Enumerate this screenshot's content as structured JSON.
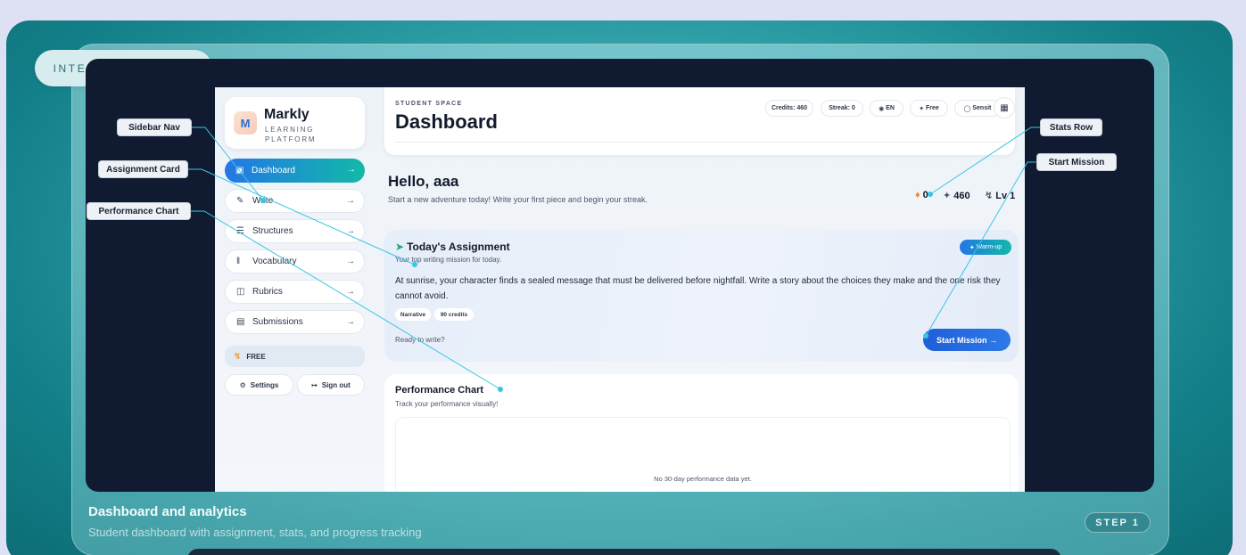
{
  "tour": {
    "badge": "INTERACTIVE TOUR",
    "footer_title": "Dashboard and analytics",
    "footer_subtitle": "Student dashboard with assignment, stats, and progress tracking",
    "step": "STEP 1"
  },
  "callouts": {
    "sidebar_nav": "Sidebar Nav",
    "assignment_card": "Assignment Card",
    "performance_chart": "Performance Chart",
    "stats_row": "Stats Row",
    "start_mission": "Start Mission"
  },
  "app": {
    "logo": {
      "name": "Markly",
      "subtitle": "LEARNING PLATFORM",
      "mark_text": "M"
    },
    "nav": [
      {
        "label": "Dashboard",
        "icon": "book-open-icon"
      },
      {
        "label": "Write",
        "icon": "pen-icon"
      },
      {
        "label": "Structures",
        "icon": "layers-icon"
      },
      {
        "label": "Vocabulary",
        "icon": "library-icon"
      },
      {
        "label": "Rubrics",
        "icon": "clipboard-icon"
      },
      {
        "label": "Submissions",
        "icon": "file-icon"
      }
    ],
    "plan": "FREE",
    "settings_label": "Settings",
    "signout_label": "Sign out",
    "header": {
      "eyebrow": "STUDENT SPACE",
      "title": "Dashboard",
      "chips": [
        "Credits: 460",
        "Streak: 0",
        "EN",
        "Free",
        "Sensit"
      ]
    },
    "greeting": "Hello, aaa",
    "greeting_sub": "Start a new adventure today! Write your first piece and begin your streak.",
    "stats": {
      "streak": "0",
      "credits": "460",
      "level": "Lv 1"
    },
    "assignment": {
      "title": "Today's Assignment",
      "subtitle": "Your top writing mission for today.",
      "body": "At sunrise, your character finds a sealed message that must be delivered before nightfall. Write a story about the choices they make and the one risk they cannot avoid.",
      "tags": [
        "Narrative",
        "90 credits"
      ],
      "badge": "Warm-up",
      "ready": "Ready to write?",
      "cta": "Start Mission →"
    },
    "performance": {
      "title": "Performance Chart",
      "subtitle": "Track your performance visually!",
      "empty": "No 30-day performance data yet."
    }
  },
  "colors": {
    "accent_blue": "#2477e6",
    "accent_teal": "#12b9a8",
    "callout_line": "#38c6e0"
  }
}
